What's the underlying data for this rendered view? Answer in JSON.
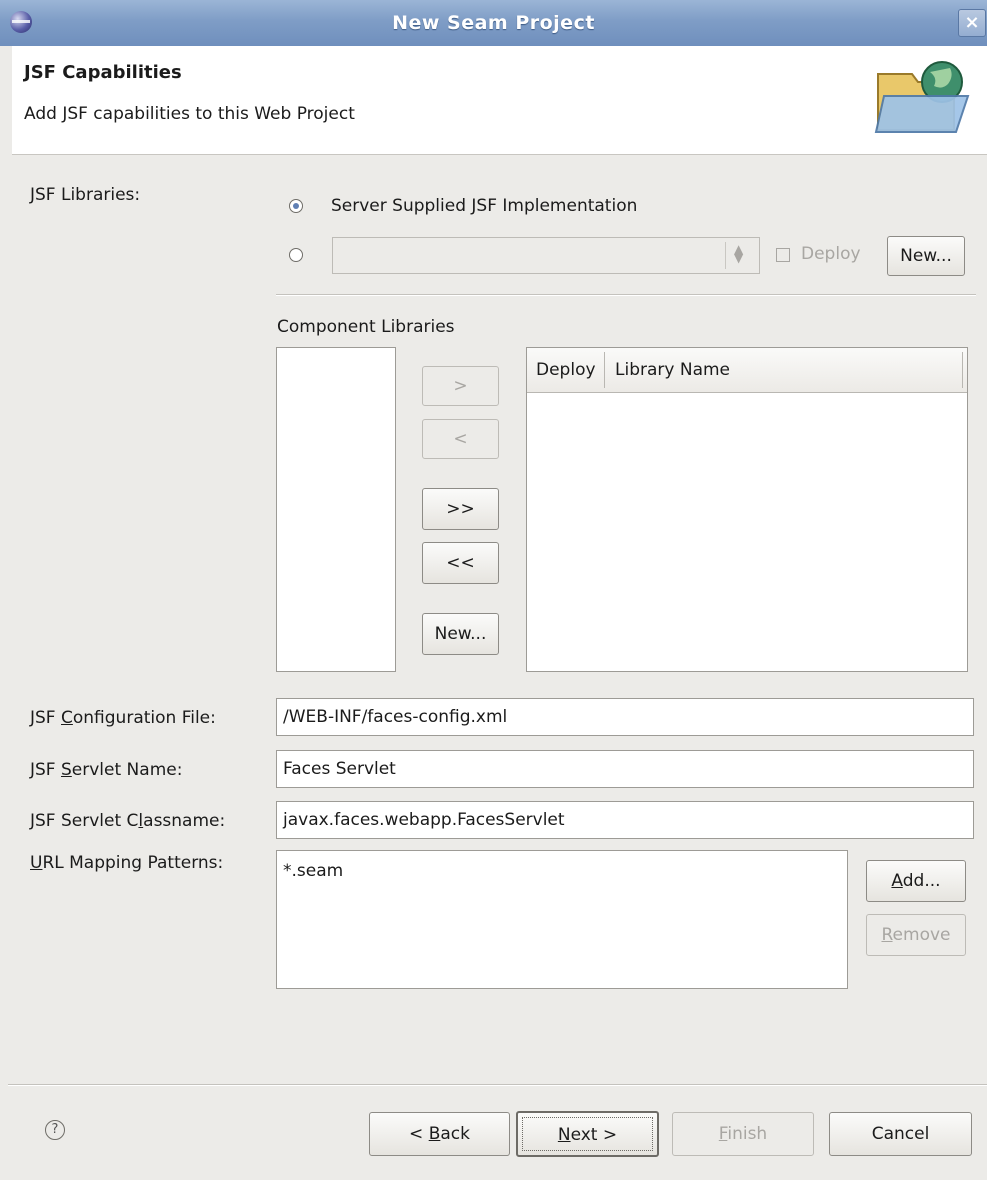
{
  "window": {
    "title": "New Seam Project",
    "close_glyph": "×"
  },
  "header": {
    "title": "JSF Capabilities",
    "subtitle": "Add JSF capabilities to this Web Project",
    "icon": "folder-globe-icon"
  },
  "jsf_libraries": {
    "label": "JSF Libraries:",
    "option_server": "Server Supplied JSF Implementation",
    "option_server_selected": true,
    "library_select_value": "",
    "deploy_label": "Deploy",
    "deploy_checked": false,
    "new_button": "New..."
  },
  "component_libraries": {
    "label": "Component Libraries",
    "buttons": {
      "add": ">",
      "remove": "<",
      "add_all": ">>",
      "remove_all": "<<",
      "new": "New..."
    },
    "columns": [
      "Deploy",
      "Library Name"
    ]
  },
  "fields": {
    "config_file": {
      "label_pre": "JSF ",
      "label_mnemonic": "C",
      "label_post": "onfiguration File:",
      "value": "/WEB-INF/faces-config.xml"
    },
    "servlet_name": {
      "label_pre": "JSF ",
      "label_mnemonic": "S",
      "label_post": "ervlet Name:",
      "value": "Faces Servlet"
    },
    "servlet_classname": {
      "label_pre": "JSF Servlet C",
      "label_mnemonic": "l",
      "label_post": "assname:",
      "value": "javax.faces.webapp.FacesServlet"
    },
    "url_mapping": {
      "label_pre": "",
      "label_mnemonic": "U",
      "label_post": "RL Mapping Patterns:",
      "values": [
        "*.seam"
      ]
    }
  },
  "url_buttons": {
    "add": {
      "mnemonic": "A",
      "rest": "dd..."
    },
    "remove": {
      "mnemonic": "R",
      "rest": "emove"
    }
  },
  "footer": {
    "help_glyph": "?",
    "back": {
      "pre": "< ",
      "mnemonic": "B",
      "rest": "ack"
    },
    "next": {
      "mnemonic": "N",
      "rest": "ext >"
    },
    "finish": {
      "mnemonic": "F",
      "rest": "inish"
    },
    "cancel": "Cancel"
  },
  "colors": {
    "titlebar": "#7f9dc6",
    "dialog_bg": "#ecebe8",
    "radio_dot": "#5f7fb3"
  }
}
